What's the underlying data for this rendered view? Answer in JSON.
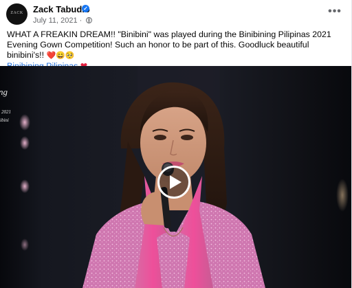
{
  "post": {
    "author": "Zack Tabudlo",
    "date": "July 11, 2021",
    "date_separator": " · ",
    "text_before_tag": "WHAT A FREAKIN DREAM!! \"Binibini\" was played during the Binibining Pilipinas 2021 Evening Gown Competition! Such an honor to be part of this. Goodluck beautiful binibini's!! ",
    "text_emojis": "❤️😄🥺",
    "hashtag": "Binibining Pilipinas",
    "hashtag_emoji": "❤",
    "more_label": "•••",
    "verified_badge": "✓",
    "audience_icon": "globe-icon"
  },
  "video": {
    "overlay_logo_line1": "ng",
    "overlay_logo_line2": "2021",
    "overlay_logo_line3": "ibini",
    "play_icon": "play-icon"
  },
  "colors": {
    "link": "#216fdb",
    "verified": "#1877f2",
    "secondary_text": "#65676b"
  }
}
